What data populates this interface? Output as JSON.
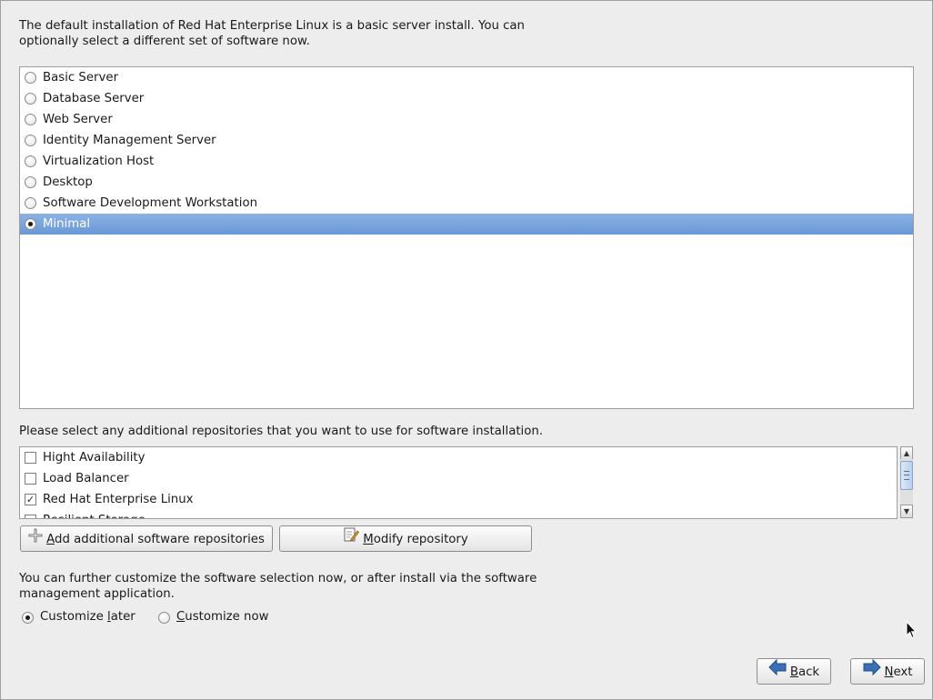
{
  "intro_text": "The default installation of Red Hat Enterprise Linux is a basic server install. You can optionally select a different set of software now.",
  "install_groups": [
    {
      "label": "Basic Server",
      "selected": false
    },
    {
      "label": "Database Server",
      "selected": false
    },
    {
      "label": "Web Server",
      "selected": false
    },
    {
      "label": "Identity Management Server",
      "selected": false
    },
    {
      "label": "Virtualization Host",
      "selected": false
    },
    {
      "label": "Desktop",
      "selected": false
    },
    {
      "label": "Software Development Workstation",
      "selected": false
    },
    {
      "label": "Minimal",
      "selected": true
    }
  ],
  "repos_prompt": "Please select any additional repositories that you want to use for software installation.",
  "repos": [
    {
      "label": "Hight Availability",
      "checked": false
    },
    {
      "label": "Load Balancer",
      "checked": false
    },
    {
      "label": "Red Hat Enterprise Linux",
      "checked": true
    },
    {
      "label": "Resilient Storage",
      "checked": false
    }
  ],
  "buttons": {
    "add_repo_mnemonic": "A",
    "add_repo_rest": "dd additional software repositories",
    "modify_repo_mnemonic": "M",
    "modify_repo_rest": "odify repository",
    "back_mnemonic": "B",
    "back_rest": "ack",
    "next_mnemonic": "N",
    "next_rest": "ext"
  },
  "customize_text": "You can further customize the software selection now, or after install via the software management application.",
  "customize_options": {
    "later_prefix": "Customize ",
    "later_mnemonic": "l",
    "later_suffix": "ater",
    "later_selected": true,
    "now_prefix": "",
    "now_mnemonic": "C",
    "now_suffix": "ustomize now",
    "now_selected": false
  },
  "colors": {
    "selection": "#7aa4dc",
    "background": "#ededed"
  }
}
